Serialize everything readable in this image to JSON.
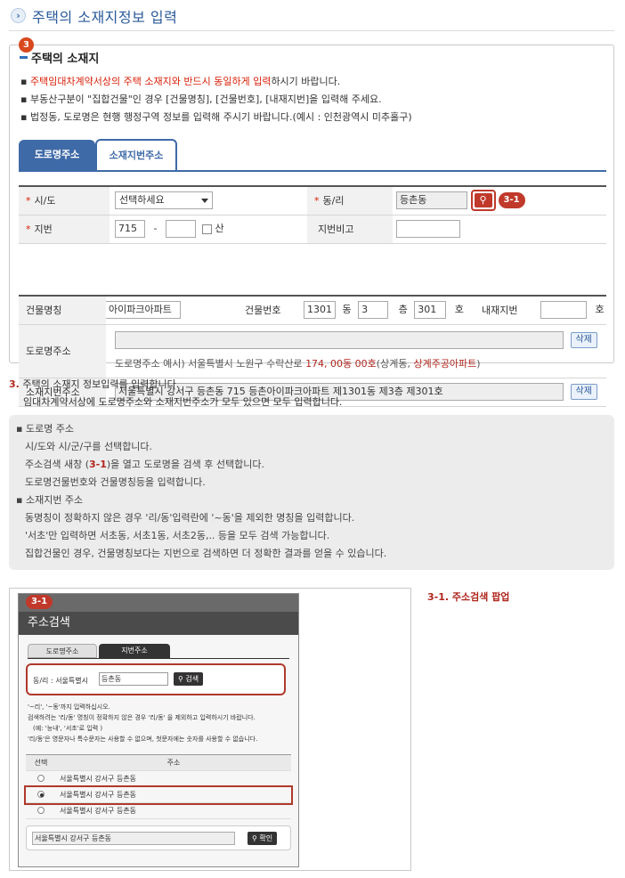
{
  "header": {
    "icon": "chevron-right-icon",
    "title": "주택의 소재지정보 입력"
  },
  "section": {
    "step_badge": "3",
    "title": "주택의 소재지",
    "bullets": {
      "b1_red": "주택임대차계약서상의 주택 소재지와 반드시 동일하게 입력",
      "b1_rest": "하시기 바랍니다.",
      "b2": "부동산구분이 \"집합건물\"인 경우 [건물명칭], [건물번호], [내재지번]을 입력해 주세요.",
      "b3": "법정동, 도로명은 현행 행정구역 정보를 입력해 주시기 바랍니다.(예시 : 인천광역시 미추홀구)"
    }
  },
  "tabs": [
    {
      "label": "도로명주소",
      "active": false
    },
    {
      "label": "소재지번주소",
      "active": true
    }
  ],
  "form_basic": {
    "sido_label": "시/도",
    "sido_value": "선택하세요",
    "dongri_label": "동/리",
    "dongri_value": "등촌동",
    "search_tag": "3-1",
    "jibun_label": "지번",
    "jibun_main": "715",
    "jibun_dash": "-",
    "jibun_sub": "",
    "san_label": "산",
    "jibun_note_label": "지번비고",
    "jibun_note_value": ""
  },
  "form_building": {
    "building_name_label": "건물명칭",
    "building_name_value": "아이파크아파트",
    "building_no_label": "건물번호",
    "dong_value": "1301",
    "dong_unit": "동",
    "floor_value": "3",
    "floor_unit": "층",
    "ho_value": "301",
    "ho_unit": "호",
    "inner_jibun_label": "내재지번",
    "inner_jibun_value": "",
    "inner_jibun_unit": "호",
    "road_label": "도로명주소",
    "road_value": "",
    "road_example_prefix": "도로명주소 예시) 서울특별시 노원구 수락산로 ",
    "road_example_num": "174, 00동 00호",
    "road_example_mid": "(상계동, ",
    "road_example_apt": "상계주공아파트",
    "road_example_end": ")",
    "jibun_addr_label": "소재지번주소",
    "jibun_addr_value": "서울특별시 강서구 등촌동  715 등촌아이파크아파트 제1301동 제3층 제301호",
    "delete_label": "삭제"
  },
  "description": {
    "num": "3.",
    "line1": "주택의 소재지 정보입력를 입력합니다.",
    "line2": "임대차계약서상에 도로명주소와 소재지번주소가 모두 있으면 모두 입력합니다."
  },
  "notes": {
    "road_title": "도로명 주소",
    "road_1": "시/도와 시/군/구를 선택합니다.",
    "road_2_pre": "주소검색 새창 (",
    "road_2_tag": "3-1",
    "road_2_post": ")을 열고 도로명을 검색 후 선택합니다.",
    "road_3": "도로명건물번호와 건물명칭등을 입력합니다.",
    "jibun_title": "소재지번 주소",
    "jibun_1": "동명칭이 정확하지 않은 경우 '리/동'입력란에 '~동'을 제외한 명칭을 입력합니다.",
    "jibun_2": "'서초'만 입력하면 서초동, 서초1동, 서초2동,.. 등을 모두 검색 가능합니다.",
    "jibun_3": "집합건물인 경우, 건물명칭보다는 지번으로 검색하면 더 정확한 결과를 얻을 수 있습니다."
  },
  "popup": {
    "badge": "3-1",
    "title": "주소검색",
    "tab_road": "도로명주소",
    "tab_jibun": "지번주소",
    "search_label": "동/리 : 서울특별시",
    "search_value": "등촌동",
    "search_btn": "검색",
    "hint1": "'~리', '~동'까지 입력하십시오.",
    "hint2": "검색하려는 '리/동' 명칭이 정확하지 않은 경우 '리/동' 을 제외하고 입력하시기 바랍니다.",
    "hint3": "(예: '능내', '서초'로 입력 )",
    "hint4": "'리/동'은 영문자나 특수문자는 사용할 수 없으며, 첫문자에는 숫자를 사용할 수 없습니다.",
    "col_select": "선택",
    "col_addr": "주소",
    "rows": [
      "서울특별시 강서구 등촌동",
      "서울특별시 강서구 등촌동",
      "서울특별시 강서구 등촌동"
    ],
    "result_value": "서울특별시 강서구 등촌동",
    "confirm_btn": "확인",
    "caption": "3-1. 주소검색 팝업"
  }
}
